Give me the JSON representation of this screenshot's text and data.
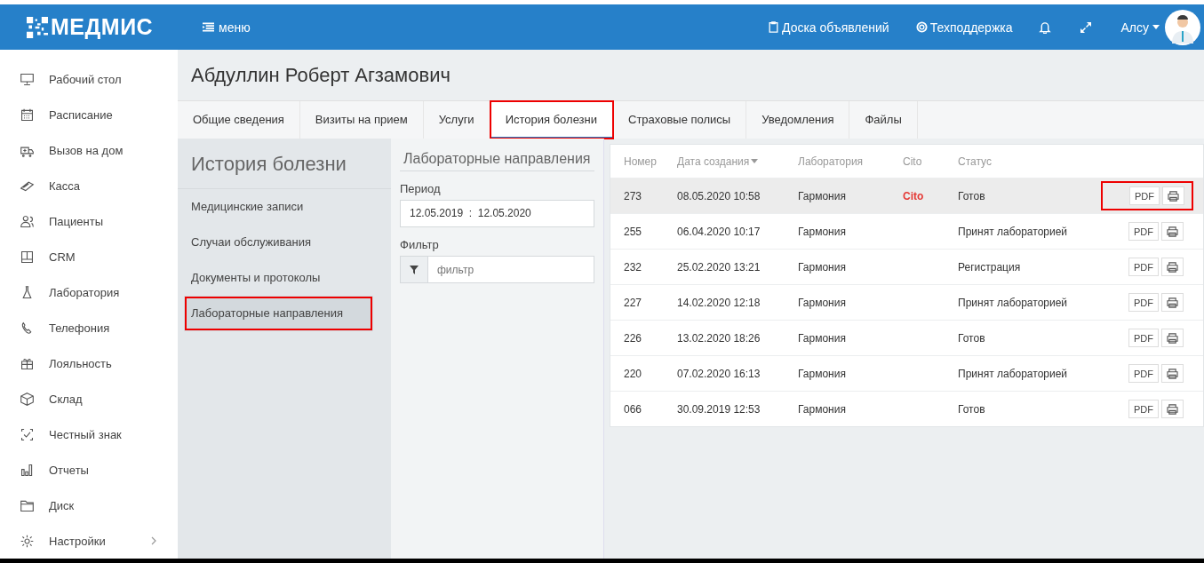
{
  "header": {
    "logo": "МЕДМИС",
    "menu_label": "меню",
    "links": [
      "Доска объявлений",
      "Техподдержка"
    ],
    "user": "Алсу"
  },
  "sidebar": {
    "items": [
      {
        "label": "Рабочий стол",
        "expandable": false
      },
      {
        "label": "Расписание",
        "expandable": false
      },
      {
        "label": "Вызов на дом",
        "expandable": false
      },
      {
        "label": "Касса",
        "expandable": false
      },
      {
        "label": "Пациенты",
        "expandable": false
      },
      {
        "label": "CRM",
        "expandable": false
      },
      {
        "label": "Лаборатория",
        "expandable": false
      },
      {
        "label": "Телефония",
        "expandable": false
      },
      {
        "label": "Лояльность",
        "expandable": false
      },
      {
        "label": "Склад",
        "expandable": false
      },
      {
        "label": "Честный знак",
        "expandable": false
      },
      {
        "label": "Отчеты",
        "expandable": false
      },
      {
        "label": "Диск",
        "expandable": false
      },
      {
        "label": "Настройки",
        "expandable": true
      }
    ]
  },
  "patient": {
    "name": "Абдуллин Роберт Агзамович"
  },
  "tabs": [
    {
      "label": "Общие сведения",
      "selected": false,
      "highlighted": false
    },
    {
      "label": "Визиты на прием",
      "selected": false,
      "highlighted": false
    },
    {
      "label": "Услуги",
      "selected": false,
      "highlighted": false
    },
    {
      "label": "История болезни",
      "selected": true,
      "highlighted": true
    },
    {
      "label": "Страховые полисы",
      "selected": false,
      "highlighted": false
    },
    {
      "label": "Уведомления",
      "selected": false,
      "highlighted": false
    },
    {
      "label": "Файлы",
      "selected": false,
      "highlighted": false
    }
  ],
  "history_nav": {
    "title": "История болезни",
    "items": [
      {
        "label": "Медицинские записи",
        "selected": false,
        "highlighted": false
      },
      {
        "label": "Случаи обслуживания",
        "selected": false,
        "highlighted": false
      },
      {
        "label": "Документы и протоколы",
        "selected": false,
        "highlighted": false
      },
      {
        "label": "Лабораторные направления",
        "selected": true,
        "highlighted": true
      }
    ]
  },
  "filters": {
    "title": "Лабораторные направления",
    "period_label": "Период",
    "date_from": "12.05.2019",
    "separator": ":",
    "date_to": "12.05.2020",
    "filter_label": "Фильтр",
    "filter_placeholder": "фильтр"
  },
  "table": {
    "columns": [
      {
        "label": "Номер",
        "sorted": false
      },
      {
        "label": "Дата создания",
        "sorted": true
      },
      {
        "label": "Лаборатория",
        "sorted": false
      },
      {
        "label": "Cito",
        "sorted": false
      },
      {
        "label": "Статус",
        "sorted": false
      }
    ],
    "rows": [
      {
        "number": "273",
        "date": "08.05.2020 10:58",
        "lab": "Гармония",
        "cito": "Cito",
        "status": "Готов",
        "pdf": "PDF",
        "selected": true,
        "highlighted": true
      },
      {
        "number": "255",
        "date": "06.04.2020 10:17",
        "lab": "Гармония",
        "status": "Принят лабораторией",
        "pdf": "PDF",
        "selected": false,
        "highlighted": false
      },
      {
        "number": "232",
        "date": "25.02.2020 13:21",
        "lab": "Гармония",
        "status": "Регистрация",
        "pdf": "PDF",
        "selected": false,
        "highlighted": false
      },
      {
        "number": "227",
        "date": "14.02.2020 12:18",
        "lab": "Гармония",
        "status": "Принят лабораторией",
        "pdf": "PDF",
        "selected": false,
        "highlighted": false
      },
      {
        "number": "226",
        "date": "13.02.2020 18:26",
        "lab": "Гармония",
        "status": "Готов",
        "pdf": "PDF",
        "selected": false,
        "highlighted": false
      },
      {
        "number": "220",
        "date": "07.02.2020 16:13",
        "lab": "Гармония",
        "status": "Принят лабораторией",
        "pdf": "PDF",
        "selected": false,
        "highlighted": false
      },
      {
        "number": "066",
        "date": "30.09.2019 12:53",
        "lab": "Гармония",
        "status": "Готов",
        "pdf": "PDF",
        "selected": false,
        "highlighted": false
      }
    ]
  }
}
